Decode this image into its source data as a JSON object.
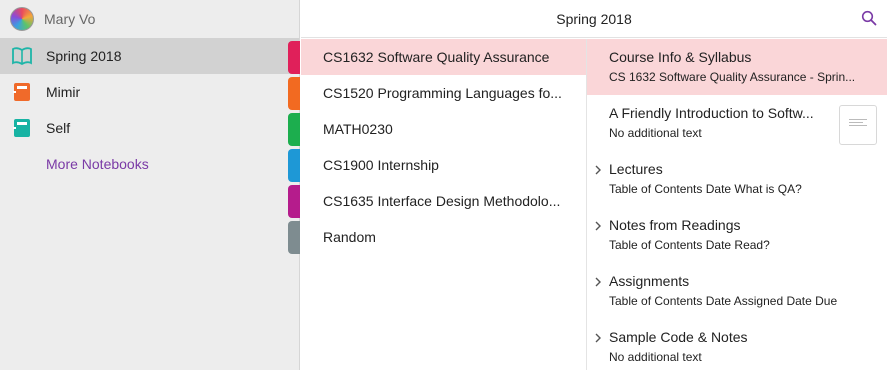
{
  "user": {
    "name": "Mary Vo"
  },
  "header": {
    "title": "Spring 2018"
  },
  "notebooks": [
    {
      "label": "Spring 2018",
      "icon": "notebook-open-icon",
      "color": "#1fb5a8",
      "selected": true
    },
    {
      "label": "Mimir",
      "icon": "notebook-icon",
      "color": "#f06a2a"
    },
    {
      "label": "Self",
      "icon": "notebook-icon",
      "color": "#17b3a3"
    }
  ],
  "more_notebooks": "More Notebooks",
  "section_colors": [
    "#e0205a",
    "#f26a21",
    "#1cae4e",
    "#1e98d6",
    "#b51c8c",
    "#7e8c90"
  ],
  "sections": [
    {
      "label": "CS1632 Software Quality Assurance",
      "selected": true
    },
    {
      "label": "CS1520 Programming Languages fo..."
    },
    {
      "label": "MATH0230"
    },
    {
      "label": "CS1900 Internship"
    },
    {
      "label": "CS1635 Interface Design Methodolo..."
    },
    {
      "label": "Random"
    }
  ],
  "pages": [
    {
      "title": "Course Info & Syllabus",
      "subtitle": "CS 1632  Software Quality Assurance - Sprin...",
      "selected": true
    },
    {
      "title": "A Friendly Introduction to Softw...",
      "subtitle": "No additional text",
      "thumbnail": true
    },
    {
      "title": "Lectures",
      "subtitle": "Table of Contents  Date  What is QA?",
      "collapsible": true
    },
    {
      "title": "Notes from Readings",
      "subtitle": "Table of Contents  Date  Read?",
      "collapsible": true
    },
    {
      "title": "Assignments",
      "subtitle": "Table of Contents  Date Assigned  Date Due",
      "collapsible": true
    },
    {
      "title": "Sample Code & Notes",
      "subtitle": "No additional text",
      "collapsible": true
    }
  ],
  "colors": {
    "accent": "#7a3aa6",
    "selection": "#fad6d8"
  }
}
